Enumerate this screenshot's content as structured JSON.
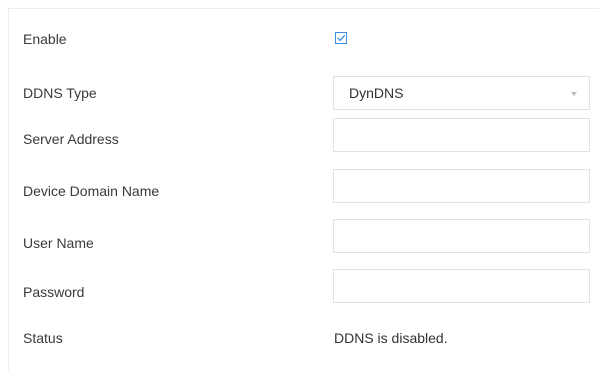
{
  "form": {
    "enable": {
      "label": "Enable",
      "checked": true
    },
    "ddns_type": {
      "label": "DDNS Type",
      "value": "DynDNS"
    },
    "server_address": {
      "label": "Server Address",
      "value": ""
    },
    "device_domain_name": {
      "label": "Device Domain Name",
      "value": ""
    },
    "user_name": {
      "label": "User Name",
      "value": ""
    },
    "password": {
      "label": "Password",
      "value": ""
    },
    "status": {
      "label": "Status",
      "value": "DDNS is disabled."
    }
  },
  "colors": {
    "accent": "#3a8ee6",
    "text": "#3a3a3a",
    "border": "#e2e2e2"
  },
  "icons": {
    "dropdown": "chevron-down-icon",
    "checkbox": "check-icon"
  }
}
